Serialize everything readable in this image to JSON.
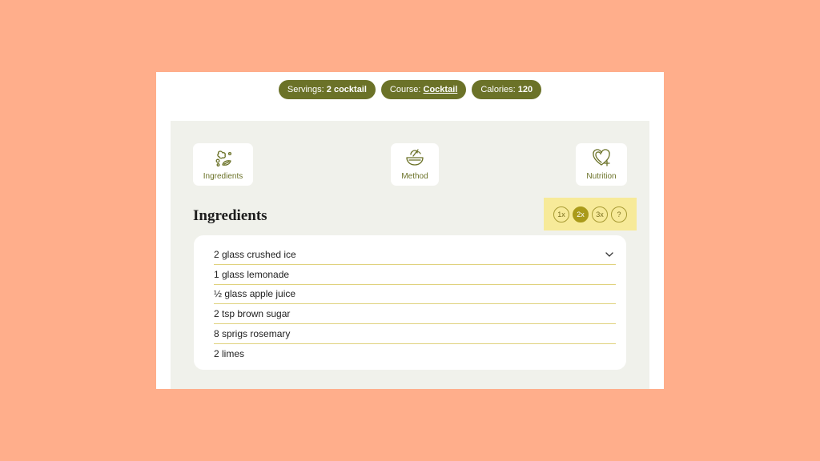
{
  "meta": {
    "servings_label": "Servings:",
    "servings_value": "2 cocktail",
    "course_label": "Course:",
    "course_value": "Cocktail",
    "calories_label": "Calories:",
    "calories_value": "120"
  },
  "tabs": [
    {
      "label": "Ingredients",
      "icon": "ingredients-icon"
    },
    {
      "label": "Method",
      "icon": "bowl-whisk-icon"
    },
    {
      "label": "Nutrition",
      "icon": "heart-plus-icon"
    }
  ],
  "section_title": "Ingredients",
  "scale_options": [
    {
      "label": "1x",
      "active": false
    },
    {
      "label": "2x",
      "active": true
    },
    {
      "label": "3x",
      "active": false
    },
    {
      "label": "?",
      "active": false
    }
  ],
  "ingredients": [
    "2 glass crushed ice",
    "1 glass lemonade",
    "½ glass apple juice",
    "2 tsp brown sugar",
    "8 sprigs rosemary",
    "2 limes"
  ],
  "colors": {
    "background": "#ffae8b",
    "accent": "#6b7228",
    "panel": "#f0f1eb",
    "highlight": "#f7ea99",
    "active_scale": "#aa9a1a"
  }
}
